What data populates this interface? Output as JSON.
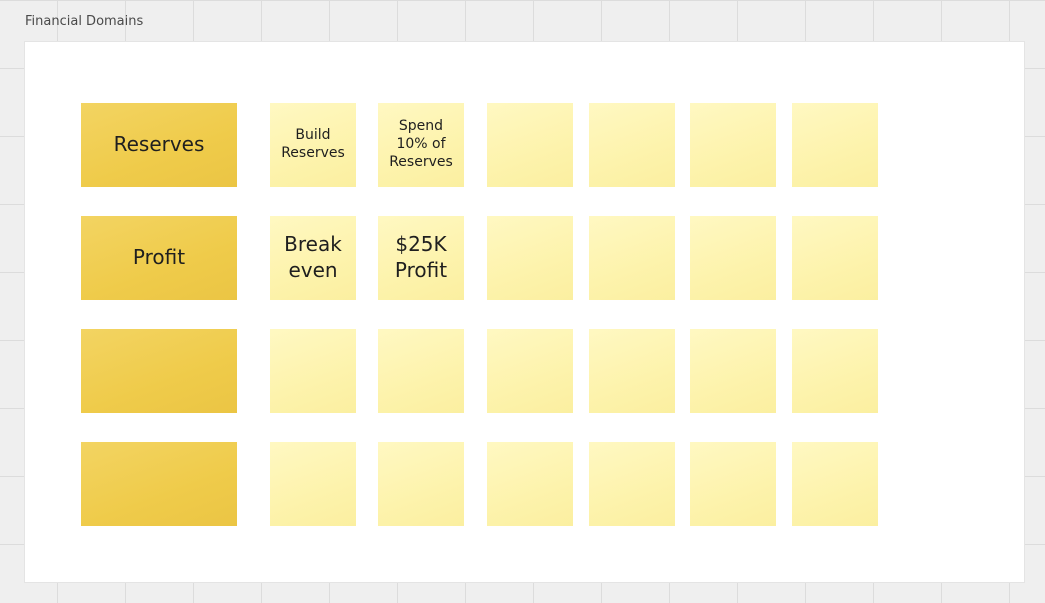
{
  "frame": {
    "title": "Financial Domains"
  },
  "board": {
    "rows": [
      {
        "label": "Reserves",
        "notes": [
          "Build\nReserves",
          "Spend\n10% of\nReserves",
          "",
          "",
          "",
          ""
        ]
      },
      {
        "label": "Profit",
        "notes": [
          "Break\neven",
          "$25K\nProfit",
          "",
          "",
          "",
          ""
        ]
      },
      {
        "label": "",
        "notes": [
          "",
          "",
          "",
          "",
          "",
          ""
        ]
      },
      {
        "label": "",
        "notes": [
          "",
          "",
          "",
          "",
          "",
          ""
        ]
      }
    ]
  },
  "colors": {
    "label_sticky": "#efcb4a",
    "note_sticky": "#fdf3ac",
    "canvas": "#efefef",
    "frame": "#ffffff"
  }
}
